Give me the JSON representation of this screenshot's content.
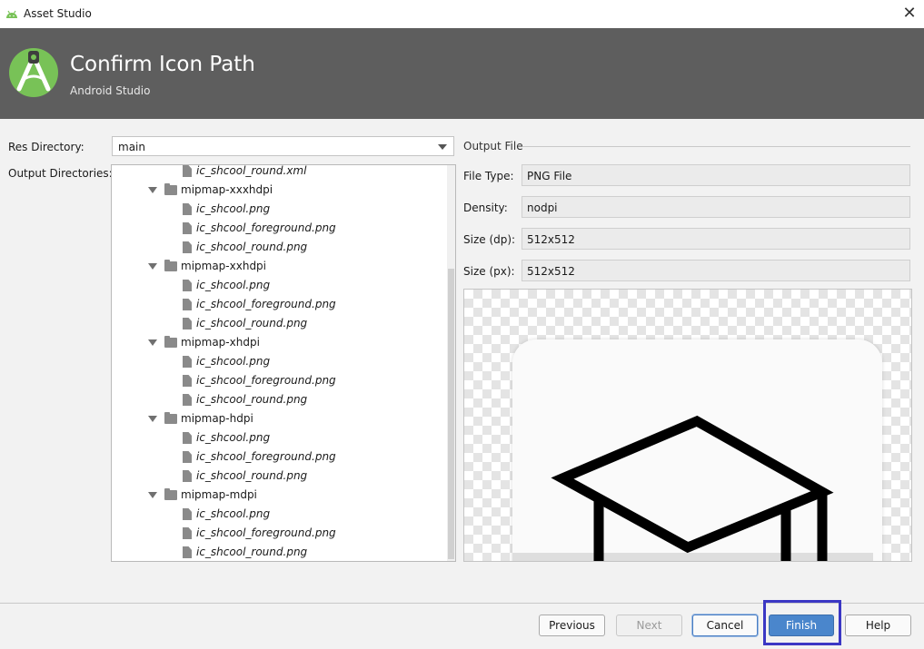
{
  "window": {
    "title": "Asset Studio",
    "close_glyph": "✕"
  },
  "banner": {
    "heading": "Confirm Icon Path",
    "subheading": "Android Studio",
    "icon": "android-studio-logo",
    "background": "#5e5e5e"
  },
  "form": {
    "res_directory_label": "Res Directory:",
    "res_directory_value": "main",
    "output_directories_label": "Output Directories:"
  },
  "tree": [
    {
      "type": "file",
      "label": "ic_shcool_round.xml"
    },
    {
      "type": "folder",
      "label": "mipmap-xxxhdpi"
    },
    {
      "type": "file",
      "label": "ic_shcool.png"
    },
    {
      "type": "file",
      "label": "ic_shcool_foreground.png"
    },
    {
      "type": "file",
      "label": "ic_shcool_round.png"
    },
    {
      "type": "folder",
      "label": "mipmap-xxhdpi"
    },
    {
      "type": "file",
      "label": "ic_shcool.png"
    },
    {
      "type": "file",
      "label": "ic_shcool_foreground.png"
    },
    {
      "type": "file",
      "label": "ic_shcool_round.png"
    },
    {
      "type": "folder",
      "label": "mipmap-xhdpi"
    },
    {
      "type": "file",
      "label": "ic_shcool.png"
    },
    {
      "type": "file",
      "label": "ic_shcool_foreground.png"
    },
    {
      "type": "file",
      "label": "ic_shcool_round.png"
    },
    {
      "type": "folder",
      "label": "mipmap-hdpi"
    },
    {
      "type": "file",
      "label": "ic_shcool.png"
    },
    {
      "type": "file",
      "label": "ic_shcool_foreground.png"
    },
    {
      "type": "file",
      "label": "ic_shcool_round.png"
    },
    {
      "type": "folder",
      "label": "mipmap-mdpi"
    },
    {
      "type": "file",
      "label": "ic_shcool.png"
    },
    {
      "type": "file",
      "label": "ic_shcool_foreground.png"
    },
    {
      "type": "file",
      "label": "ic_shcool_round.png"
    }
  ],
  "output_file": {
    "section_label": "Output File",
    "file_type_label": "File Type:",
    "file_type_value": "PNG File",
    "density_label": "Density:",
    "density_value": "nodpi",
    "size_dp_label": "Size (dp):",
    "size_dp_value": "512x512",
    "size_px_label": "Size (px):",
    "size_px_value": "512x512",
    "preview_icon": "graduation-cap-icon"
  },
  "buttons": {
    "previous": "Previous",
    "next": "Next",
    "cancel": "Cancel",
    "finish": "Finish",
    "help": "Help"
  },
  "colors": {
    "accent": "#4a86cc",
    "highlight": "#3b37c4"
  }
}
